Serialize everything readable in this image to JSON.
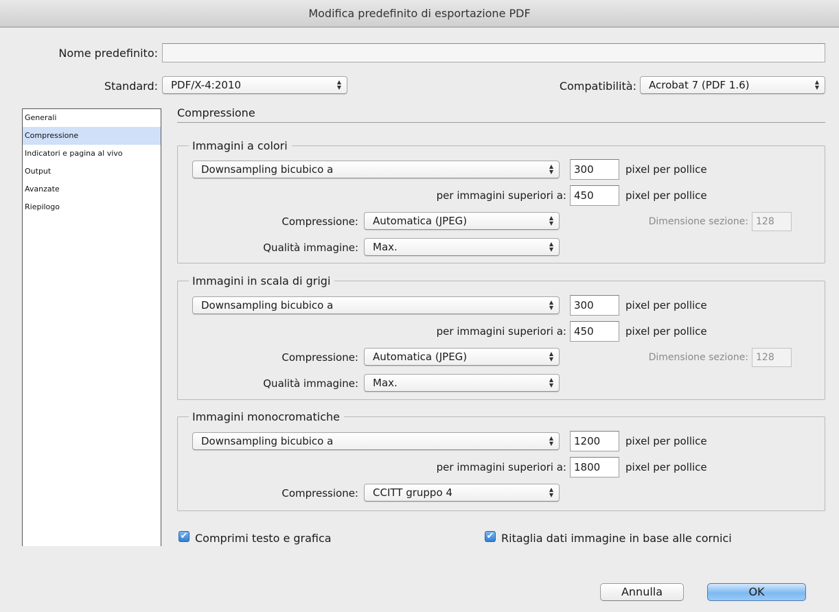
{
  "window": {
    "title": "Modifica predefinito di esportazione PDF"
  },
  "header": {
    "preset_label": "Nome predefinito:",
    "preset_value": "",
    "standard_label": "Standard:",
    "standard_value": "PDF/X-4:2010",
    "compat_label": "Compatibilità:",
    "compat_value": "Acrobat 7 (PDF 1.6)"
  },
  "sidebar": {
    "items": [
      {
        "label": "Generali"
      },
      {
        "label": "Compressione",
        "selected": true
      },
      {
        "label": "Indicatori e pagina al vivo"
      },
      {
        "label": "Output"
      },
      {
        "label": "Avanzate"
      },
      {
        "label": "Riepilogo"
      }
    ]
  },
  "main": {
    "section_title": "Compressione",
    "color": {
      "title": "Immagini a colori",
      "sampling": "Downsampling bicubico a",
      "ppi": "300",
      "ppi_unit": "pixel per pollice",
      "above_label": "per immagini superiori a:",
      "above_value": "450",
      "above_unit": "pixel per pollice",
      "compression_label": "Compressione:",
      "compression_value": "Automatica (JPEG)",
      "tile_label": "Dimensione sezione:",
      "tile_value": "128",
      "quality_label": "Qualità immagine:",
      "quality_value": "Max."
    },
    "gray": {
      "title": "Immagini in scala di grigi",
      "sampling": "Downsampling bicubico a",
      "ppi": "300",
      "ppi_unit": "pixel per pollice",
      "above_label": "per immagini superiori a:",
      "above_value": "450",
      "above_unit": "pixel per pollice",
      "compression_label": "Compressione:",
      "compression_value": "Automatica (JPEG)",
      "tile_label": "Dimensione sezione:",
      "tile_value": "128",
      "quality_label": "Qualità immagine:",
      "quality_value": "Max."
    },
    "mono": {
      "title": "Immagini monocromatiche",
      "sampling": "Downsampling bicubico a",
      "ppi": "1200",
      "ppi_unit": "pixel per pollice",
      "above_label": "per immagini superiori a:",
      "above_value": "1800",
      "above_unit": "pixel per pollice",
      "compression_label": "Compressione:",
      "compression_value": "CCITT gruppo 4"
    },
    "compress_text_label": "Comprimi testo e grafica",
    "compress_text_checked": true,
    "crop_label": "Ritaglia dati immagine in base alle cornici",
    "crop_checked": true
  },
  "footer": {
    "cancel_label": "Annulla",
    "ok_label": "OK"
  },
  "icons": {
    "popup_arrows": "updown-arrows-icon",
    "checkmark": "checkmark-icon"
  },
  "colors": {
    "selection": "#cfe0f8",
    "default_button": "#7db9f2",
    "checkbox": "#2f7fd6"
  }
}
